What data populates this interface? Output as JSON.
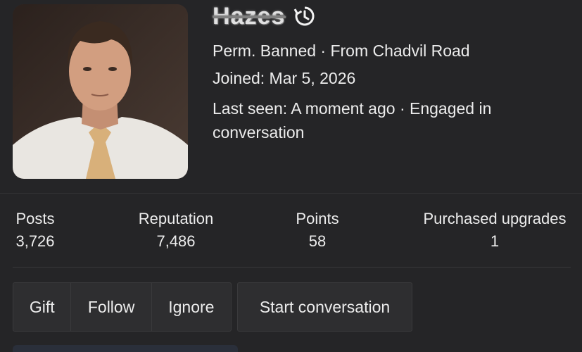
{
  "profile": {
    "username": "Hazes",
    "status_line": "Perm. Banned · From Chadvil Road",
    "joined": "Joined: Mar 5, 2026",
    "last_seen": "Last seen: A moment ago · Engaged in conversation"
  },
  "stats": [
    {
      "label": "Posts",
      "value": "3,726"
    },
    {
      "label": "Reputation",
      "value": "7,486"
    },
    {
      "label": "Points",
      "value": "58"
    },
    {
      "label": "Purchased upgrades",
      "value": "1"
    }
  ],
  "actions": {
    "gift": "Gift",
    "follow": "Follow",
    "ignore": "Ignore",
    "start_conversation": "Start conversation"
  },
  "icons": {
    "history": "history-icon"
  }
}
